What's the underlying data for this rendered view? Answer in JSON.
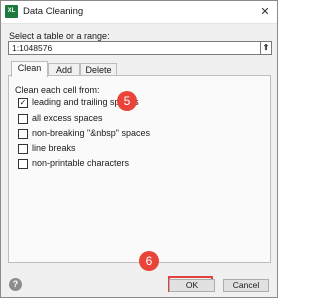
{
  "window": {
    "title": "Data Cleaning",
    "app_icon_text": "XL",
    "close_glyph": "✕"
  },
  "range": {
    "label": "Select a table or a range:",
    "value": "1:1048576",
    "picker_glyph": "⇑"
  },
  "tabs": [
    {
      "label": "Clean",
      "active": true
    },
    {
      "label": "Add",
      "active": false
    },
    {
      "label": "Delete",
      "active": false
    }
  ],
  "clean": {
    "label": "Clean each cell from:",
    "options": [
      {
        "label": "leading and trailing spaces",
        "checked": true
      },
      {
        "label": "all excess spaces",
        "checked": false
      },
      {
        "label": "non-breaking \"&nbsp\" spaces",
        "checked": false
      },
      {
        "label": "line breaks",
        "checked": false
      },
      {
        "label": "non-printable characters",
        "checked": false
      }
    ]
  },
  "annotations": {
    "step5": "5",
    "step6": "6",
    "color": "#e8443a"
  },
  "footer": {
    "help_glyph": "?",
    "ok_label": "OK",
    "cancel_label": "Cancel"
  }
}
